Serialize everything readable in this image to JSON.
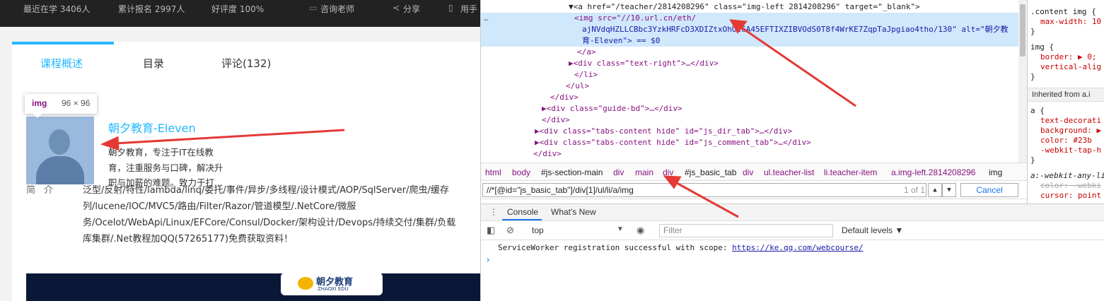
{
  "topbar": {
    "learning": "最近在学 3406人",
    "enrolled": "累计报名 2997人",
    "rating": "好评度 100%",
    "consult": "咨询老师",
    "share": "分享",
    "phone": "用手"
  },
  "tabs": [
    {
      "label": "课程概述"
    },
    {
      "label": "目录"
    },
    {
      "label": "评论(132)"
    }
  ],
  "tooltip": {
    "tag": "img",
    "size": "96 × 96"
  },
  "teacher": {
    "name": "朝夕教育-Eleven",
    "desc": [
      "朝夕教育，专注于IT在线教",
      "育，注重服务与口碑，解决升",
      "职与加薪的难题。致力于打..."
    ]
  },
  "intro": {
    "label": "简介",
    "lines": [
      "泛型/反射/特性/lambda/linq/委托/事件/异步/多线程/设计模式/AOP/SqlServer/爬虫/缓存",
      "列/lucene/IOC/MVC5/路由/Filter/Razor/管道模型/.NetCore/微服",
      "务/Ocelot/WebApi/Linux/EFCore/Consul/Docker/架构设计/Devops/持续交付/集群/负载",
      "库集群/.Net教程加QQ(57265177)免费获取资料！"
    ]
  },
  "banner": {
    "logo_cn": "朝夕教育",
    "logo_en": "ZHAOXI EDU"
  },
  "elements": {
    "a_line": "▼<a href=\"/teacher/2814208296\" class=\"img-left 2814208296\" target=\"_blank\">",
    "img_line1": "<img src=\"//10.url.cn/eth/",
    "img_line2": "ajNVdqHZLLCBbc3YzkHRFcD3XDIZtxOhU2GA45EFTIXZIBVOdS0T8f4WrKE7ZqpTaJpgiao4tho/130\" alt=\"朝夕教",
    "img_line3": "育-Eleven\"> == $0",
    "l_a_close": "</a>",
    "l_div_text": "▶<div class=\"text-right\">…</div>",
    "l_li_close": "</li>",
    "l_ul_close": "</ul>",
    "l_div_close": "</div>",
    "l_guide": "▶<div class=\"guide-bd\">…</div>",
    "l_div_close2": "</div>",
    "l_dir": "▶<div class=\"tabs-content hide\" id=\"js_dir_tab\">…</div>",
    "l_comment": "▶<div class=\"tabs-content hide\" id=\"js_comment_tab\">…</div>",
    "l_div_close3": "</div>",
    "ellipsis": "…"
  },
  "breadcrumbs": [
    "html",
    "body",
    "#js-section-main",
    "div",
    "main",
    "div",
    "#js_basic_tab",
    "div",
    "ul.teacher-list",
    "li.teacher-item",
    "a.img-left.2814208296",
    "img"
  ],
  "search": {
    "value": "//*[@id=\"js_basic_tab\"]/div[1]/ul/li/a/img",
    "count": "1 of 1",
    "cancel": "Cancel"
  },
  "styles": {
    "rule1_sel": ".content img {",
    "rule1_prop": "max-width: 10",
    "rule1_close": "}",
    "rule2_sel": "img {",
    "rule2_p1": "border: ▶ 0;",
    "rule2_p2": "vertical-alig",
    "rule2_close": "}",
    "inherited": "Inherited from a.i",
    "rule3_sel": "a {",
    "rule3_p1": "text-decorati",
    "rule3_p2": "background: ▶",
    "rule3_p3": "color: #23b",
    "rule3_p4": "-webkit-tap-h",
    "rule3_close": "}",
    "rule4_sel": "a:-webkit-any-li",
    "rule4_p1": "color: -webki",
    "rule4_p2": "cursor: point"
  },
  "drawer": {
    "tab_console": "Console",
    "tab_whatsnew": "What's New",
    "context": "top",
    "filter_placeholder": "Filter",
    "levels": "Default levels ▼",
    "message": "ServiceWorker registration successful with scope:",
    "message_link": "https://ke.qq.com/webcourse/",
    "prompt": "›"
  },
  "colors": {
    "accent": "#23b8ff",
    "devtools_highlight": "#cfe8fc",
    "annotation_arrow": "#e53935"
  }
}
